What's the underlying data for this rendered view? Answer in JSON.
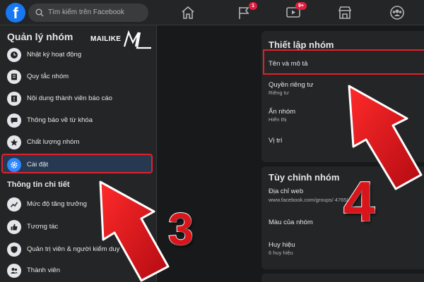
{
  "topbar": {
    "logo": "f",
    "search_placeholder": "Tìm kiếm trên Facebook",
    "badges": {
      "pages": "1",
      "watch": "9+"
    }
  },
  "watermark": "MAILIKE",
  "sidebar": {
    "title": "Quản lý nhóm",
    "items": [
      {
        "label": "Nhật ký hoạt động",
        "icon": "clock-icon"
      },
      {
        "label": "Quy tắc nhóm",
        "icon": "book-icon"
      },
      {
        "label": "Nội dung thành viên báo cáo",
        "icon": "report-icon"
      },
      {
        "label": "Thông báo về từ khóa",
        "icon": "speech-bubble-icon"
      },
      {
        "label": "Chất lượng nhóm",
        "icon": "star-icon"
      },
      {
        "label": "Cài đặt",
        "icon": "gear-icon"
      }
    ],
    "insights_title": "Thông tin chi tiết",
    "insights": [
      {
        "label": "Mức độ tăng trưởng",
        "icon": "growth-chart-icon"
      },
      {
        "label": "Tương tác",
        "icon": "thumbs-up-icon"
      },
      {
        "label": "Quản trị viên & người kiểm duy",
        "icon": "shield-icon"
      },
      {
        "label": "Thành viên",
        "icon": "members-icon"
      }
    ]
  },
  "settings": {
    "title": "Thiết lập nhóm",
    "rows": [
      {
        "title": "Tên và mô tả",
        "sub": ""
      },
      {
        "title": "Quyền riêng tư",
        "sub": "Riêng tư"
      },
      {
        "title": "Ẩn nhóm",
        "sub": "Hiển thị"
      },
      {
        "title": "Vị trí",
        "sub": ""
      }
    ]
  },
  "customize": {
    "title": "Tùy chỉnh nhóm",
    "rows": [
      {
        "title": "Địa chỉ web",
        "sub": "www.facebook.com/groups/                    4765/"
      },
      {
        "title": "Màu của nhóm",
        "sub": ""
      },
      {
        "title": "Huy hiệu",
        "sub": "6 huy hiệu"
      }
    ]
  },
  "steps": {
    "left": "3",
    "right": "4"
  },
  "colors": {
    "highlight": "#e0212b",
    "brand": "#1877f2",
    "arrow": "#d9141b"
  }
}
